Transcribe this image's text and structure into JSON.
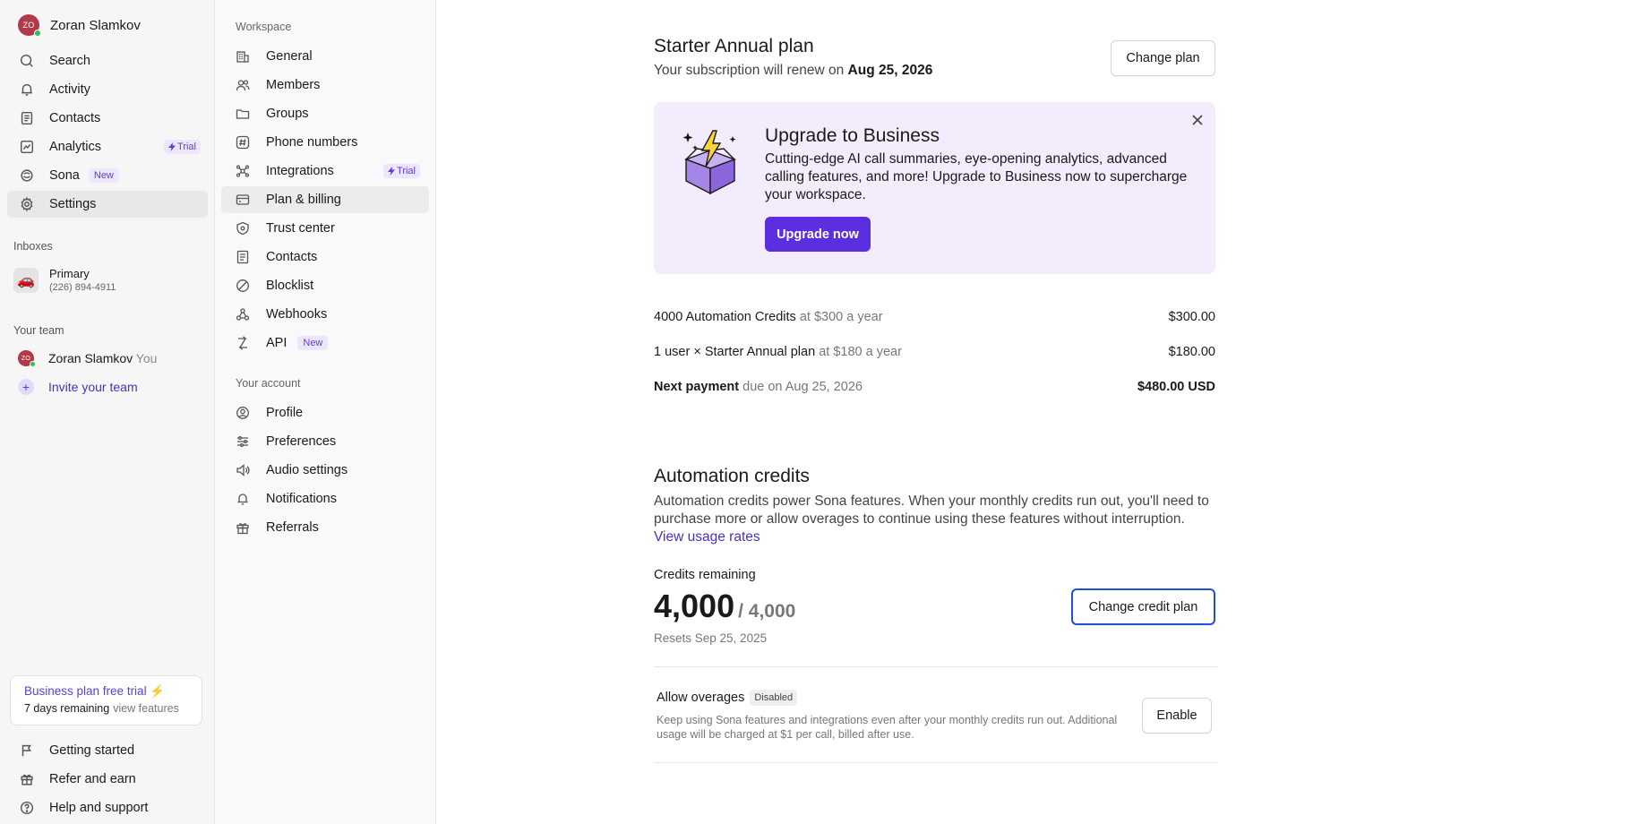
{
  "user": {
    "initials": "ZO",
    "name": "Zoran Slamkov"
  },
  "nav": {
    "search": "Search",
    "activity": "Activity",
    "contacts": "Contacts",
    "analytics": "Analytics",
    "analytics_badge": "Trial",
    "sona": "Sona",
    "sona_badge": "New",
    "settings": "Settings"
  },
  "inboxes": {
    "label": "Inboxes",
    "primary": {
      "name": "Primary",
      "phone": "(226) 894-4911",
      "icon": "car-icon"
    }
  },
  "team": {
    "label": "Your team",
    "member_initials": "ZO",
    "member_name": "Zoran Slamkov",
    "member_you": "You",
    "invite": "Invite your team"
  },
  "trial_card": {
    "title": "Business plan free trial ⚡",
    "remaining": "7 days remaining",
    "view": "view features"
  },
  "footer": {
    "getting_started": "Getting started",
    "refer": "Refer and earn",
    "help": "Help and support"
  },
  "settings_nav": {
    "workspace_label": "Workspace",
    "general": "General",
    "members": "Members",
    "groups": "Groups",
    "phone_numbers": "Phone numbers",
    "integrations": "Integrations",
    "integrations_badge": "Trial",
    "plan_billing": "Plan & billing",
    "trust_center": "Trust center",
    "contacts": "Contacts",
    "blocklist": "Blocklist",
    "webhooks": "Webhooks",
    "api": "API",
    "api_badge": "New",
    "account_label": "Your account",
    "profile": "Profile",
    "preferences": "Preferences",
    "audio": "Audio settings",
    "notifications": "Notifications",
    "referrals": "Referrals"
  },
  "plan": {
    "title": "Starter Annual plan",
    "renew_prefix": "Your subscription will renew on",
    "renew_date": "Aug 25, 2026",
    "change_plan": "Change plan"
  },
  "promo": {
    "title": "Upgrade to Business",
    "text": "Cutting-edge AI call summaries, eye-opening analytics, advanced calling features, and more! Upgrade to Business now to supercharge your workspace.",
    "button": "Upgrade now"
  },
  "billing": {
    "line1_label": "4000 Automation Credits",
    "line1_rate": "at $300 a year",
    "line1_amount": "$300.00",
    "line2_label": "1 user × Starter Annual plan",
    "line2_rate": "at $180 a year",
    "line2_amount": "$180.00",
    "next_label": "Next payment",
    "next_due": "due on Aug 25, 2026",
    "next_amount": "$480.00 USD"
  },
  "credits": {
    "title": "Automation credits",
    "description": "Automation credits power Sona features. When your monthly credits run out, you'll need to purchase more or allow overages to continue using these features without interruption.",
    "link": "View usage rates",
    "remaining_label": "Credits remaining",
    "remaining": "4,000",
    "total": "/ 4,000",
    "resets": "Resets Sep 25, 2025",
    "change_button": "Change credit plan",
    "overages_label": "Allow overages",
    "overages_status": "Disabled",
    "overages_text": "Keep using Sona features and integrations even after your monthly credits run out. Additional usage will be charged at $1 per call, billed after use.",
    "enable_button": "Enable"
  },
  "colors": {
    "accent": "#5b2ee0",
    "promo_bg": "#f3ecfc",
    "online": "#2fbf56"
  }
}
